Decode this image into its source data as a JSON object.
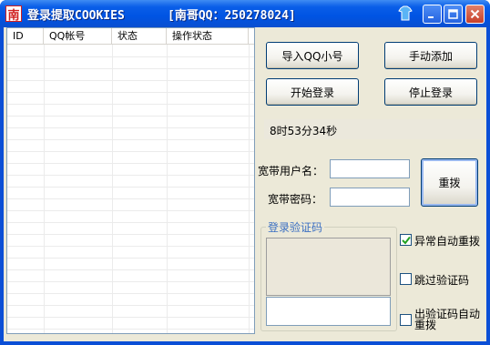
{
  "window": {
    "title": "登录提取COOKIES",
    "subtitle": "[南哥QQ：250278024]",
    "app_icon_char": "南",
    "title_icons": [
      "skin-icon",
      "minimize-icon",
      "maximize-icon",
      "close-icon"
    ]
  },
  "listview": {
    "columns": [
      "ID",
      "QQ帐号",
      "状态",
      "操作状态"
    ],
    "rows": []
  },
  "buttons": {
    "import_qq": "导入QQ小号",
    "manual_add": "手动添加",
    "start_login": "开始登录",
    "stop_login": "停止登录",
    "redial": "重拨"
  },
  "timer": "8时53分34秒",
  "broadband": {
    "user_label": "宽带用户名：",
    "user_value": "",
    "pass_label": "宽带密码：",
    "pass_value": ""
  },
  "captcha_group": {
    "title": "登录验证码",
    "input_value": ""
  },
  "checkboxes": [
    {
      "label": "异常自动重拨",
      "checked": true
    },
    {
      "label": "跳过验证码",
      "checked": false
    },
    {
      "label_line1": "出验证码自动",
      "label_line2": "重拨",
      "checked": false
    }
  ],
  "colors": {
    "titlebar": "#0054e3",
    "face": "#ece9d8",
    "button_border": "#003c74",
    "group_title": "#3b6fc2"
  }
}
